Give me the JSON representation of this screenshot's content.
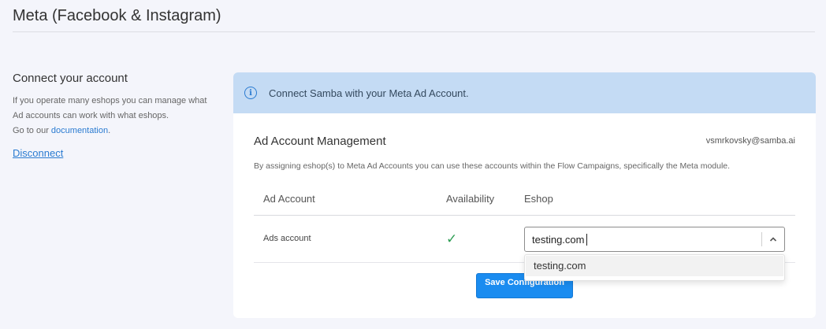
{
  "page": {
    "title": "Meta (Facebook & Instagram)"
  },
  "connect": {
    "title": "Connect your account",
    "desc_line1": "If you operate many eshops you can manage what",
    "desc_line2": "Ad accounts can work with what eshops.",
    "desc_prefix": "Go to our ",
    "doc_link": "documentation",
    "desc_suffix": ".",
    "disconnect": "Disconnect"
  },
  "card": {
    "banner_text": "Connect Samba with your Meta Ad Account.",
    "info_icon": "info-icon",
    "mgmt_title": "Ad Account Management",
    "email": "vsmrkovsky@samba.ai",
    "description": "By assigning eshop(s) to Meta Ad Accounts you can use these accounts within the Flow Campaigns, specifically the Meta module.",
    "table": {
      "headers": [
        "Ad Account",
        "Availability",
        "Eshop"
      ],
      "rows": [
        {
          "account": "Ads account",
          "availability_icon": "check-icon",
          "eshop_value": "testing.com"
        }
      ]
    },
    "dropdown_options": [
      "testing.com"
    ],
    "save_label": "Save Configuration",
    "colors": {
      "accent": "#1a8cf0",
      "banner": "#c4dbf4",
      "check": "#2e9e54"
    }
  }
}
